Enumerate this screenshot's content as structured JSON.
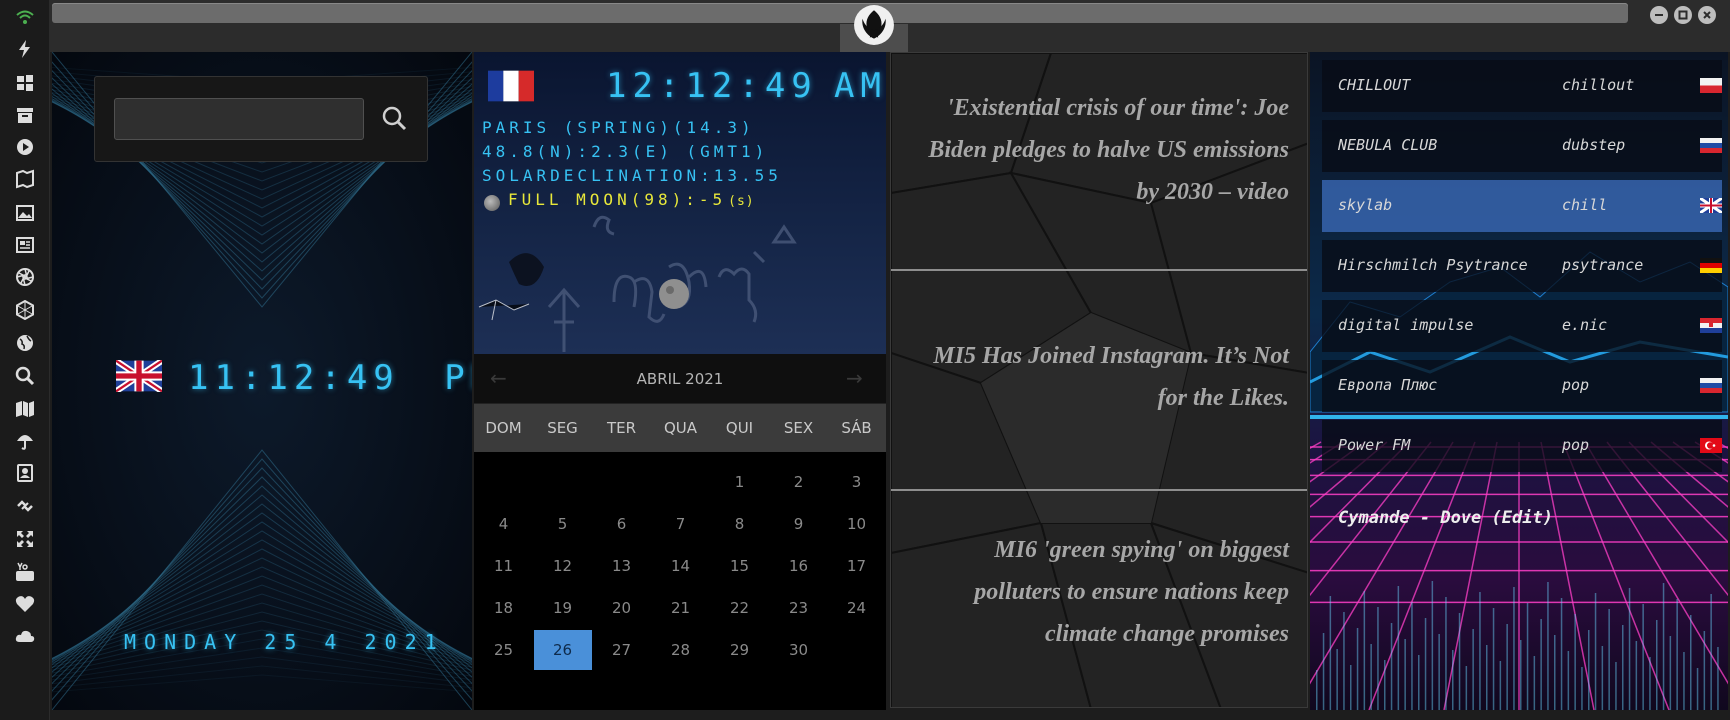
{
  "rail": {
    "icons": [
      "wifi-icon",
      "lightning-icon",
      "windows-icon",
      "archive-icon",
      "play-icon",
      "map-book-icon",
      "image-icon",
      "news-icon",
      "aperture-icon",
      "hexagon-icon",
      "globe-icon",
      "search-icon",
      "map-icon",
      "umbrella-icon",
      "contacts-icon",
      "link-icon",
      "expand-icon",
      "youtube-icon",
      "heart-icon",
      "cloud-icon"
    ]
  },
  "clock_panel": {
    "search_value": "",
    "time": "11:12:49",
    "ampm": "PM",
    "date": "MONDAY 25 4 2021"
  },
  "astro": {
    "time": "12:12:49",
    "ampm": "AM",
    "line1": "PARIS (SPRING)(14.3)",
    "line2": "48.8(N):2.3(E) (GMT1)",
    "line3": "SOLARDECLINATION:13.55",
    "moon": "FULL MOON(98):-5",
    "moon_suffix": "(s)"
  },
  "calendar": {
    "prev": "←",
    "next": "→",
    "month": "ABRIL 2021",
    "weekdays": [
      "DOM",
      "SEG",
      "TER",
      "QUA",
      "QUI",
      "SEX",
      "SÁB"
    ],
    "weeks": [
      [
        "",
        "",
        "",
        "",
        "1",
        "2",
        "3"
      ],
      [
        "4",
        "5",
        "6",
        "7",
        "8",
        "9",
        "10"
      ],
      [
        "11",
        "12",
        "13",
        "14",
        "15",
        "16",
        "17"
      ],
      [
        "18",
        "19",
        "20",
        "21",
        "22",
        "23",
        "24"
      ],
      [
        "25",
        "26",
        "27",
        "28",
        "29",
        "30",
        ""
      ]
    ],
    "selected_day": "26"
  },
  "news": [
    "'Existential crisis of our time': Joe Biden pledges to halve US emissions by 2030 – video",
    "MI5 Has Joined Instagram. It’s Not for the Likes.",
    "MI6 'green spying' on biggest polluters to ensure nations keep climate change promises"
  ],
  "radio": {
    "stations": [
      {
        "name": "CHILLOUT",
        "genre": "chillout",
        "flag": "pl"
      },
      {
        "name": "NEBULA CLUB",
        "genre": "dubstep",
        "flag": "ru"
      },
      {
        "name": "skylab",
        "genre": "chill",
        "flag": "gb",
        "active": true
      },
      {
        "name": "Hirschmilch Psytrance",
        "genre": "psytrance",
        "flag": "de"
      },
      {
        "name": "digital impulse",
        "genre": "e.nic",
        "flag": "hr"
      },
      {
        "name": "Европа Плюс",
        "genre": "pop",
        "flag": "ru"
      },
      {
        "name": "Power FM",
        "genre": "pop",
        "flag": "tr"
      }
    ],
    "now_playing": "Cymande - Dove (Edit)"
  },
  "colors": {
    "digital": "#37c2f3",
    "moon_text": "#e8e83a",
    "calendar_selected": "#4a90d9",
    "active_station": "#3c6ebe"
  }
}
